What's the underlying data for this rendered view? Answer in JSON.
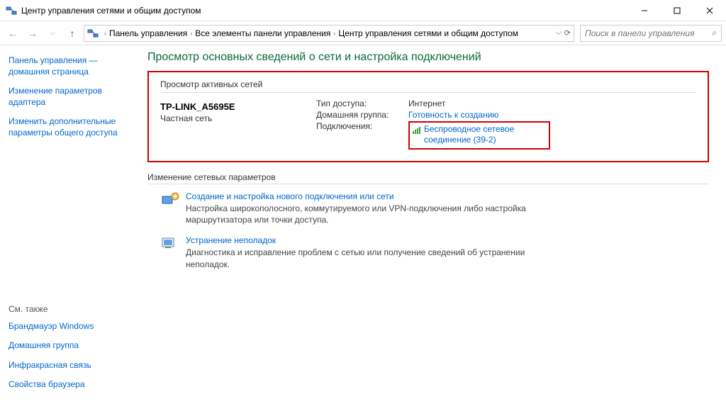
{
  "window": {
    "title": "Центр управления сетями и общим доступом"
  },
  "breadcrumbs": [
    "Панель управления",
    "Все элементы панели управления",
    "Центр управления сетями и общим доступом"
  ],
  "search": {
    "placeholder": "Поиск в панели управления"
  },
  "sidebar": {
    "links": [
      "Панель управления — домашняя страница",
      "Изменение параметров адаптера",
      "Изменить дополнительные параметры общего доступа"
    ],
    "see_also_title": "См. также",
    "see_also": [
      "Брандмауэр Windows",
      "Домашняя группа",
      "Инфракрасная связь",
      "Свойства браузера"
    ]
  },
  "main": {
    "heading": "Просмотр основных сведений о сети и настройка подключений",
    "active_nets_title": "Просмотр активных сетей",
    "network": {
      "name": "TP-LINK_A5695E",
      "type": "Частная сеть",
      "access_label": "Тип доступа:",
      "access_value": "Интернет",
      "homegroup_label": "Домашняя группа:",
      "homegroup_value": "Готовность к созданию",
      "conn_label": "Подключения:",
      "conn_value": "Беспроводное сетевое соединение (39-2)"
    },
    "change_title": "Изменение сетевых параметров",
    "options": [
      {
        "link": "Создание и настройка нового подключения или сети",
        "desc": "Настройка широкополосного, коммутируемого или VPN-подключения либо настройка маршрутизатора или точки доступа."
      },
      {
        "link": "Устранение неполадок",
        "desc": "Диагностика и исправление проблем с сетью или получение сведений об устранении неполадок."
      }
    ]
  }
}
